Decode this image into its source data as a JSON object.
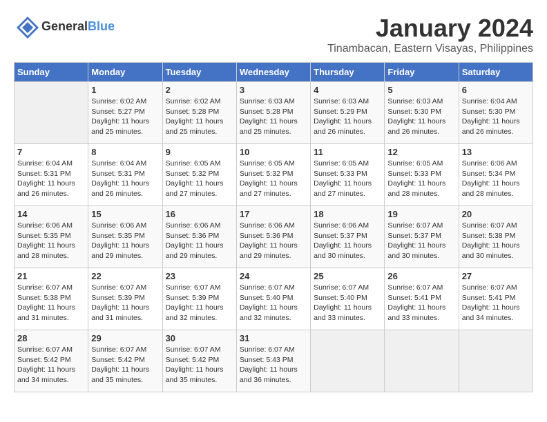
{
  "header": {
    "logo_general": "General",
    "logo_blue": "Blue",
    "month_year": "January 2024",
    "location": "Tinambacan, Eastern Visayas, Philippines"
  },
  "calendar": {
    "days_of_week": [
      "Sunday",
      "Monday",
      "Tuesday",
      "Wednesday",
      "Thursday",
      "Friday",
      "Saturday"
    ],
    "weeks": [
      [
        {
          "day": "",
          "info": ""
        },
        {
          "day": "1",
          "info": "Sunrise: 6:02 AM\nSunset: 5:27 PM\nDaylight: 11 hours\nand 25 minutes."
        },
        {
          "day": "2",
          "info": "Sunrise: 6:02 AM\nSunset: 5:28 PM\nDaylight: 11 hours\nand 25 minutes."
        },
        {
          "day": "3",
          "info": "Sunrise: 6:03 AM\nSunset: 5:28 PM\nDaylight: 11 hours\nand 25 minutes."
        },
        {
          "day": "4",
          "info": "Sunrise: 6:03 AM\nSunset: 5:29 PM\nDaylight: 11 hours\nand 26 minutes."
        },
        {
          "day": "5",
          "info": "Sunrise: 6:03 AM\nSunset: 5:30 PM\nDaylight: 11 hours\nand 26 minutes."
        },
        {
          "day": "6",
          "info": "Sunrise: 6:04 AM\nSunset: 5:30 PM\nDaylight: 11 hours\nand 26 minutes."
        }
      ],
      [
        {
          "day": "7",
          "info": "Sunrise: 6:04 AM\nSunset: 5:31 PM\nDaylight: 11 hours\nand 26 minutes."
        },
        {
          "day": "8",
          "info": "Sunrise: 6:04 AM\nSunset: 5:31 PM\nDaylight: 11 hours\nand 26 minutes."
        },
        {
          "day": "9",
          "info": "Sunrise: 6:05 AM\nSunset: 5:32 PM\nDaylight: 11 hours\nand 27 minutes."
        },
        {
          "day": "10",
          "info": "Sunrise: 6:05 AM\nSunset: 5:32 PM\nDaylight: 11 hours\nand 27 minutes."
        },
        {
          "day": "11",
          "info": "Sunrise: 6:05 AM\nSunset: 5:33 PM\nDaylight: 11 hours\nand 27 minutes."
        },
        {
          "day": "12",
          "info": "Sunrise: 6:05 AM\nSunset: 5:33 PM\nDaylight: 11 hours\nand 28 minutes."
        },
        {
          "day": "13",
          "info": "Sunrise: 6:06 AM\nSunset: 5:34 PM\nDaylight: 11 hours\nand 28 minutes."
        }
      ],
      [
        {
          "day": "14",
          "info": "Sunrise: 6:06 AM\nSunset: 5:35 PM\nDaylight: 11 hours\nand 28 minutes."
        },
        {
          "day": "15",
          "info": "Sunrise: 6:06 AM\nSunset: 5:35 PM\nDaylight: 11 hours\nand 29 minutes."
        },
        {
          "day": "16",
          "info": "Sunrise: 6:06 AM\nSunset: 5:36 PM\nDaylight: 11 hours\nand 29 minutes."
        },
        {
          "day": "17",
          "info": "Sunrise: 6:06 AM\nSunset: 5:36 PM\nDaylight: 11 hours\nand 29 minutes."
        },
        {
          "day": "18",
          "info": "Sunrise: 6:06 AM\nSunset: 5:37 PM\nDaylight: 11 hours\nand 30 minutes."
        },
        {
          "day": "19",
          "info": "Sunrise: 6:07 AM\nSunset: 5:37 PM\nDaylight: 11 hours\nand 30 minutes."
        },
        {
          "day": "20",
          "info": "Sunrise: 6:07 AM\nSunset: 5:38 PM\nDaylight: 11 hours\nand 30 minutes."
        }
      ],
      [
        {
          "day": "21",
          "info": "Sunrise: 6:07 AM\nSunset: 5:38 PM\nDaylight: 11 hours\nand 31 minutes."
        },
        {
          "day": "22",
          "info": "Sunrise: 6:07 AM\nSunset: 5:39 PM\nDaylight: 11 hours\nand 31 minutes."
        },
        {
          "day": "23",
          "info": "Sunrise: 6:07 AM\nSunset: 5:39 PM\nDaylight: 11 hours\nand 32 minutes."
        },
        {
          "day": "24",
          "info": "Sunrise: 6:07 AM\nSunset: 5:40 PM\nDaylight: 11 hours\nand 32 minutes."
        },
        {
          "day": "25",
          "info": "Sunrise: 6:07 AM\nSunset: 5:40 PM\nDaylight: 11 hours\nand 33 minutes."
        },
        {
          "day": "26",
          "info": "Sunrise: 6:07 AM\nSunset: 5:41 PM\nDaylight: 11 hours\nand 33 minutes."
        },
        {
          "day": "27",
          "info": "Sunrise: 6:07 AM\nSunset: 5:41 PM\nDaylight: 11 hours\nand 34 minutes."
        }
      ],
      [
        {
          "day": "28",
          "info": "Sunrise: 6:07 AM\nSunset: 5:42 PM\nDaylight: 11 hours\nand 34 minutes."
        },
        {
          "day": "29",
          "info": "Sunrise: 6:07 AM\nSunset: 5:42 PM\nDaylight: 11 hours\nand 35 minutes."
        },
        {
          "day": "30",
          "info": "Sunrise: 6:07 AM\nSunset: 5:42 PM\nDaylight: 11 hours\nand 35 minutes."
        },
        {
          "day": "31",
          "info": "Sunrise: 6:07 AM\nSunset: 5:43 PM\nDaylight: 11 hours\nand 36 minutes."
        },
        {
          "day": "",
          "info": ""
        },
        {
          "day": "",
          "info": ""
        },
        {
          "day": "",
          "info": ""
        }
      ]
    ]
  }
}
